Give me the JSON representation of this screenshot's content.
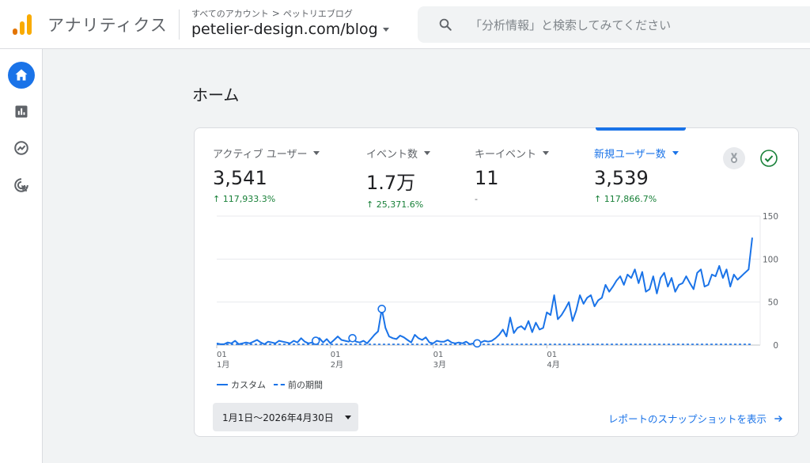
{
  "header": {
    "app_name": "アナリティクス",
    "breadcrumb": [
      "すべてのアカウント",
      "ペットリエブログ"
    ],
    "breadcrumb_sep": ">",
    "property": "petelier-design.com/blog",
    "search_placeholder": "「分析情報」と検索してみてください"
  },
  "sidenav": {
    "items": [
      {
        "icon": "home-icon",
        "active": true
      },
      {
        "icon": "reports-icon",
        "active": false
      },
      {
        "icon": "explore-icon",
        "active": false
      },
      {
        "icon": "advertising-icon",
        "active": false
      }
    ]
  },
  "page": {
    "title": "ホーム"
  },
  "metrics": [
    {
      "label": "アクティブ ユーザー",
      "value": "3,541",
      "delta": "↑ 117,933.3%",
      "selected": false
    },
    {
      "label": "イベント数",
      "value": "1.7万",
      "delta": "↑ 25,371.6%",
      "selected": false
    },
    {
      "label": "キーイベント",
      "value": "11",
      "delta": "-",
      "selected": false
    },
    {
      "label": "新規ユーザー数",
      "value": "3,539",
      "delta": "↑ 117,866.7%",
      "selected": true
    }
  ],
  "chart_data": {
    "type": "line",
    "y_ticks": [
      "150",
      "100",
      "50",
      "0"
    ],
    "ylim": [
      0,
      150
    ],
    "x_ticks": [
      {
        "day": "01",
        "month": "1月"
      },
      {
        "day": "01",
        "month": "2月"
      },
      {
        "day": "01",
        "month": "3月"
      },
      {
        "day": "01",
        "month": "4月"
      }
    ],
    "series": [
      {
        "name": "カスタム",
        "style": "solid",
        "color": "#1a73e8",
        "values": [
          2,
          1,
          1,
          3,
          2,
          5,
          1,
          2,
          3,
          2,
          4,
          6,
          3,
          1,
          4,
          3,
          2,
          5,
          4,
          3,
          2,
          5,
          3,
          8,
          4,
          2,
          3,
          5,
          8,
          3,
          7,
          2,
          6,
          10,
          6,
          5,
          4,
          8,
          4,
          3,
          5,
          2,
          7,
          12,
          16,
          42,
          20,
          10,
          8,
          7,
          11,
          9,
          6,
          3,
          12,
          8,
          6,
          9,
          3,
          2,
          5,
          4,
          4,
          6,
          3,
          2,
          3,
          2,
          4,
          1,
          2,
          2,
          3,
          5,
          4,
          5,
          8,
          12,
          18,
          10,
          32,
          14,
          20,
          22,
          18,
          28,
          15,
          26,
          18,
          20,
          38,
          35,
          58,
          30,
          35,
          42,
          50,
          28,
          40,
          58,
          48,
          55,
          58,
          45,
          52,
          55,
          70,
          62,
          68,
          75,
          80,
          70,
          82,
          78,
          88,
          72,
          85,
          62,
          65,
          80,
          60,
          78,
          84,
          68,
          78,
          62,
          70,
          72,
          80,
          72,
          65,
          84,
          88,
          68,
          70,
          82,
          80,
          92,
          78,
          88,
          68,
          82,
          76,
          80,
          84,
          88,
          125
        ]
      },
      {
        "name": "前の期間",
        "style": "dashed",
        "color": "#1a73e8",
        "values": []
      }
    ]
  },
  "legend": {
    "custom": "カスタム",
    "previous": "前の期間"
  },
  "footer": {
    "date_range": "1月1日～2026年4月30日",
    "snapshot_link": "レポートのスナップショットを表示"
  }
}
